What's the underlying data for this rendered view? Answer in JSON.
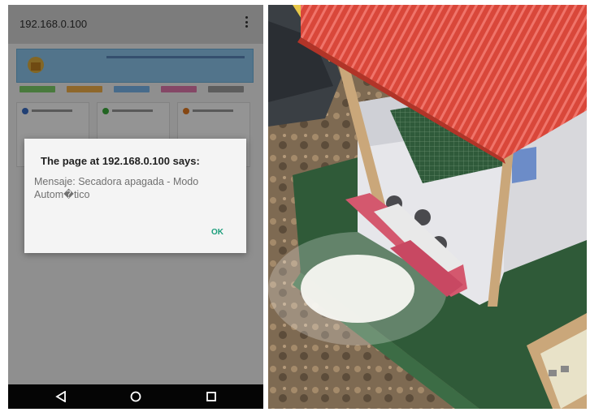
{
  "phone": {
    "url": "192.168.0.100",
    "dialog": {
      "title": "The page at 192.168.0.100 says:",
      "message": "Mensaje: Secadora apagada - Modo Autom�tico",
      "ok_label": "OK"
    },
    "nav": {
      "back_icon": "triangle-back-icon",
      "home_icon": "circle-home-icon",
      "recents_icon": "square-recents-icon"
    },
    "colors": {
      "accent": "#1c9e7c",
      "banner": "#8ec9ef",
      "tabs": [
        "#7fd36a",
        "#f4b24a",
        "#7bb8ef",
        "#e67ab0",
        "#a0a0a0"
      ]
    }
  },
  "photo": {
    "icon": "model-house-photo"
  }
}
